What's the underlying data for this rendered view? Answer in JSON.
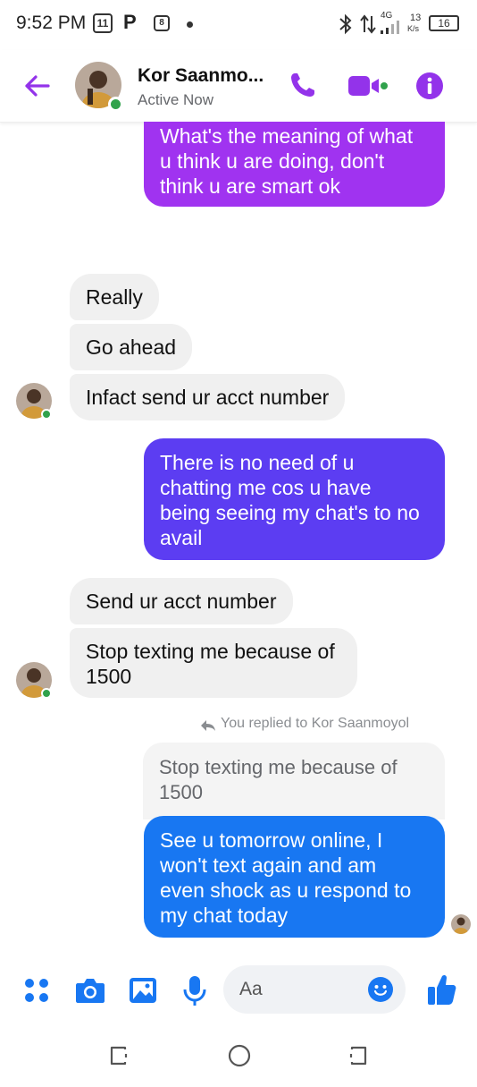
{
  "status_bar": {
    "time": "9:52 PM",
    "icon_box_label": "11",
    "p_label": "P",
    "net_label": "4G",
    "speed_value": "13",
    "speed_unit": "K/s",
    "battery": "16"
  },
  "header": {
    "contact_name": "Kor Saanmo...",
    "status": "Active Now",
    "accent_color": "#9333ea",
    "online_color": "#31a24c"
  },
  "messages": [
    {
      "text_lines": [
        "What's the meaning of what",
        "u think u are doing, don't",
        "think u are smart ok"
      ],
      "direction": "outgoing",
      "color": "#a033f0"
    },
    {
      "text": "Really",
      "direction": "incoming"
    },
    {
      "text": "Go ahead",
      "direction": "incoming"
    },
    {
      "text": "Infact send ur acct number",
      "direction": "incoming"
    },
    {
      "text_lines": [
        "There is no need of u",
        "chatting me cos u have",
        "being seeing my chat's to no",
        "avail"
      ],
      "direction": "outgoing",
      "color": "#5c3df2"
    },
    {
      "text": "Send ur acct number",
      "direction": "incoming"
    },
    {
      "text_lines": [
        "Stop texting me because of",
        "1500"
      ],
      "direction": "incoming"
    },
    {
      "text_lines": [
        "See u tomorrow online, I",
        "won't text again and am",
        "even shock as u respond to",
        "my chat today"
      ],
      "direction": "outgoing",
      "color": "#1877f2"
    }
  ],
  "reply": {
    "note": "You replied to Kor Saanmoyol",
    "quoted_lines": [
      "Stop texting me because of",
      "1500"
    ]
  },
  "composer": {
    "placeholder": "Aa",
    "icon_color": "#1877f2"
  }
}
